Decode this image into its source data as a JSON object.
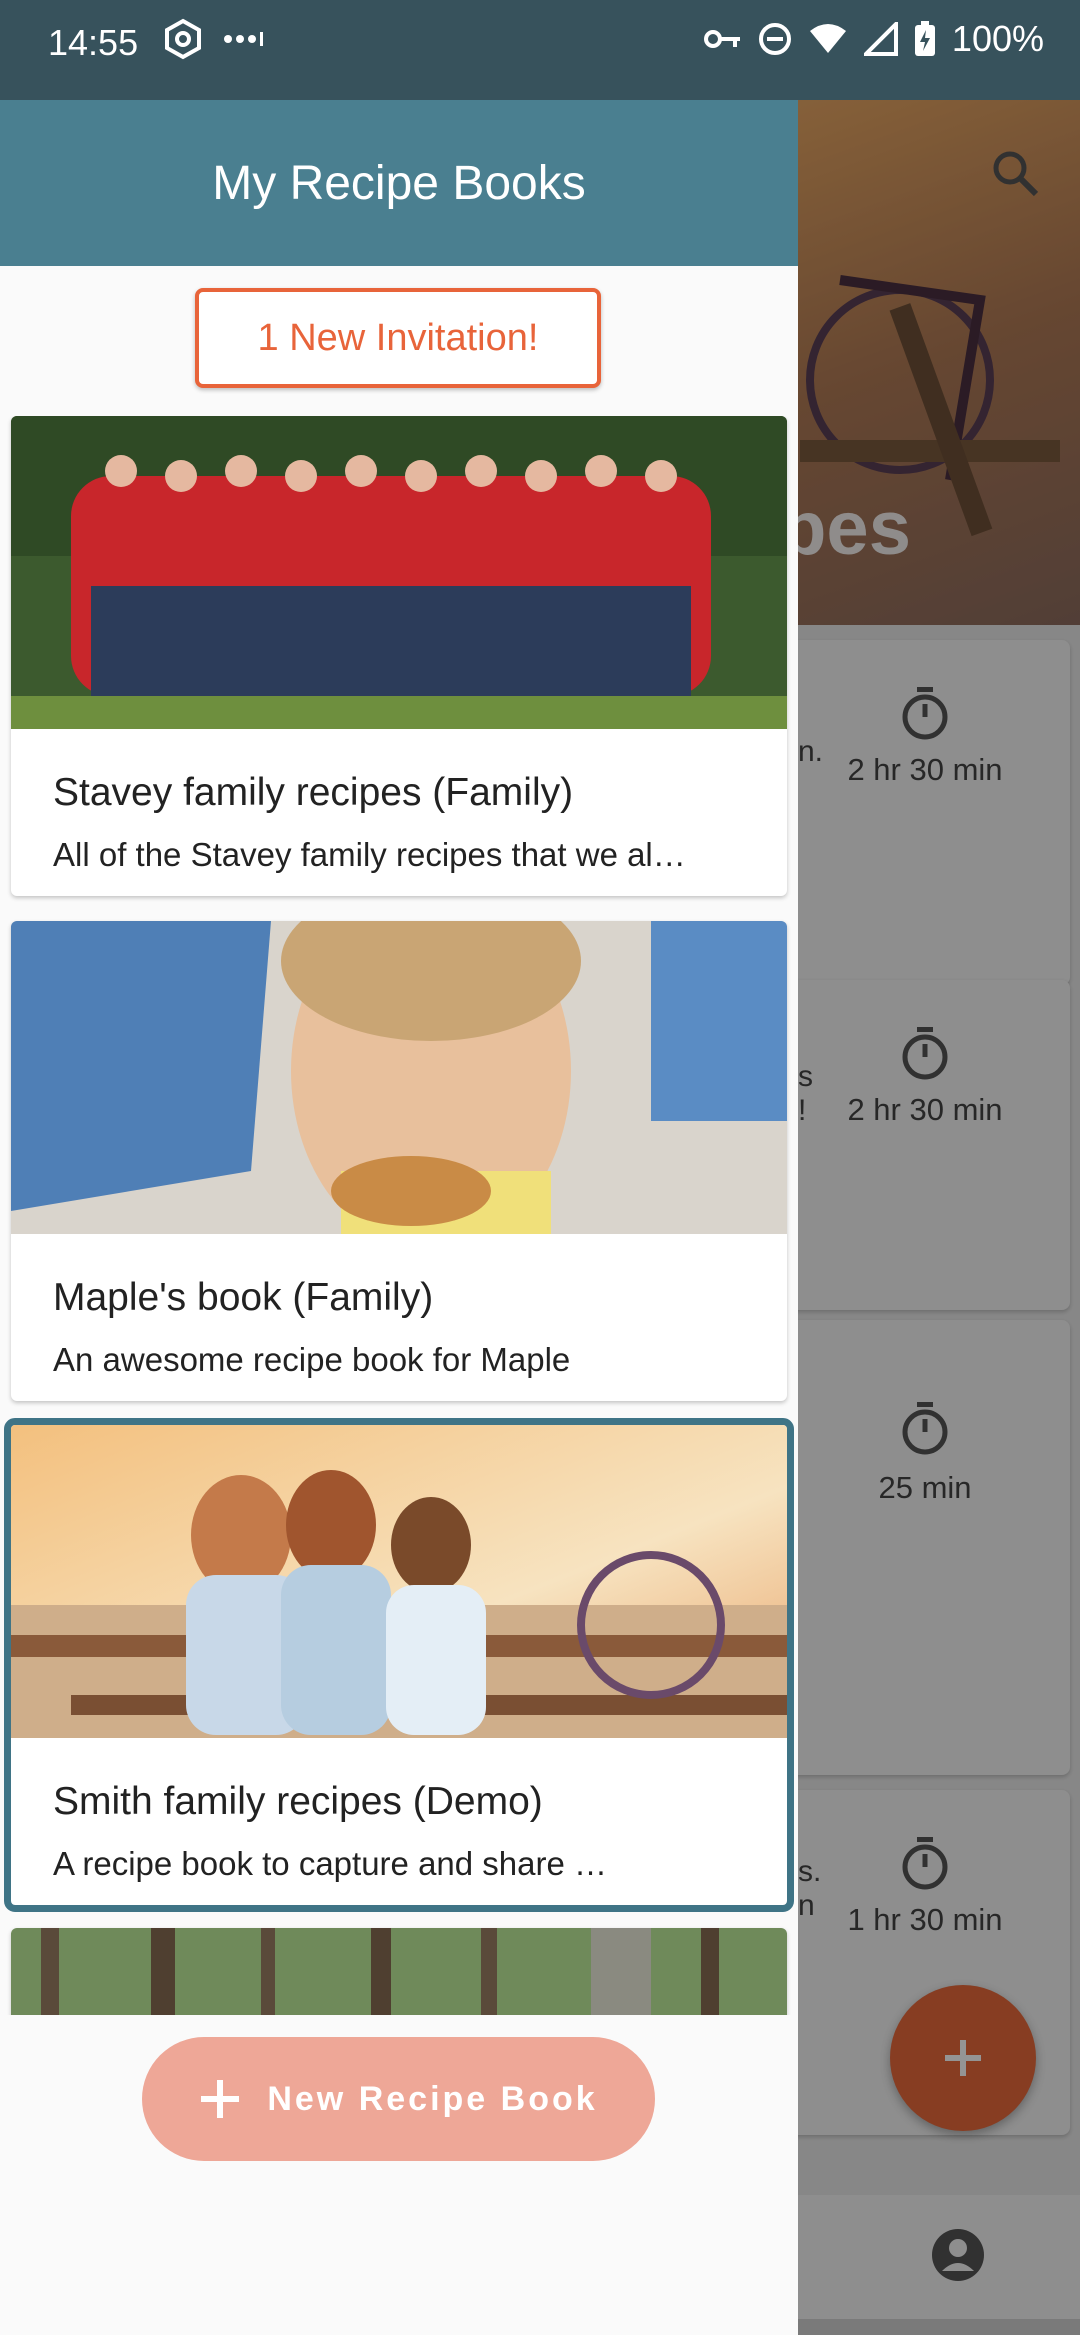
{
  "status_bar": {
    "time": "14:55",
    "battery": "100%"
  },
  "background": {
    "hero_title_fragment": "pes",
    "cards": [
      {
        "duration": "2 hr 30 min",
        "fragment": "n."
      },
      {
        "duration": "2 hr 30 min",
        "fragment": "s\n!"
      },
      {
        "duration": "25 min",
        "fragment": ""
      },
      {
        "duration": "1 hr 30 min",
        "fragment": "s.\nn"
      }
    ]
  },
  "drawer": {
    "title": "My Recipe Books",
    "invite_label": "1 New Invitation!",
    "books": [
      {
        "title": "Stavey family recipes (Family)",
        "description": "All of the Stavey family recipes that we al…",
        "image": "family-group-photo"
      },
      {
        "title": "Maple's book (Family)",
        "description": "An awesome recipe book for Maple",
        "image": "child-eating-photo"
      },
      {
        "title": "Smith family recipes (Demo)",
        "description": "A recipe book to capture and share …",
        "image": "family-on-bench-photo"
      },
      {
        "title": "",
        "description": "",
        "image": "forest-photo"
      }
    ],
    "new_book_label": "New Recipe Book"
  },
  "colors": {
    "header": "#4a7f90",
    "accent": "#e8643a",
    "selected_outline": "#3f7486",
    "status_bar": "#37525c"
  }
}
